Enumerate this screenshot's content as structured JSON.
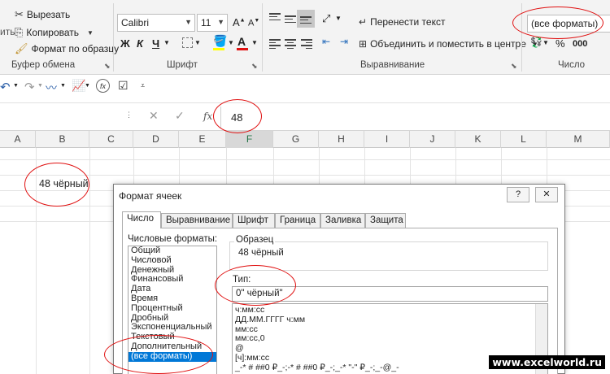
{
  "ribbon": {
    "clipboard": {
      "cut": "Вырезать",
      "copy": "Копировать",
      "format_painter": "Формат по образцу",
      "group_label": "Буфер обмена",
      "paste_fragment": "ить"
    },
    "font": {
      "name": "Calibri",
      "size": "11",
      "bold": "Ж",
      "italic": "К",
      "underline": "Ч",
      "grow": "A",
      "shrink": "A",
      "group_label": "Шрифт"
    },
    "alignment": {
      "wrap_text": "Перенести текст",
      "merge_center": "Объединить и поместить в центре",
      "group_label": "Выравнивание"
    },
    "number": {
      "format_value": "(все форматы)",
      "percent": "%",
      "comma": "000",
      "group_label": "Число"
    }
  },
  "formula_bar": {
    "value": "48",
    "fx": "fx"
  },
  "columns": [
    "A",
    "B",
    "C",
    "D",
    "E",
    "F",
    "G",
    "H",
    "I",
    "J",
    "K",
    "L",
    "M"
  ],
  "cell_b": "48 чёрный",
  "dialog": {
    "title": "Формат ячеек",
    "help": "?",
    "close": "✕",
    "tabs": [
      "Число",
      "Выравнивание",
      "Шрифт",
      "Граница",
      "Заливка",
      "Защита"
    ],
    "formats_label": "Числовые форматы:",
    "formats": [
      "Общий",
      "Числовой",
      "Денежный",
      "Финансовый",
      "Дата",
      "Время",
      "Процентный",
      "Дробный",
      "Экспоненциальный",
      "Текстовый",
      "Дополнительный",
      "(все форматы)"
    ],
    "selected_format_index": 11,
    "sample_label": "Образец",
    "sample_value": "48 чёрный",
    "type_label": "Тип:",
    "type_value": "0\" чёрный\"",
    "type_list": [
      "ч:мм:сс",
      "ДД.ММ.ГГГГ ч:мм",
      "мм:сс",
      "мм:сс,0",
      "@",
      "[ч]:мм:сс",
      "_-* # ##0 ₽_-;-* # ##0 ₽_-;_-* \"-\" ₽_-;_-@_-"
    ]
  },
  "watermark": "www.excelworld.ru",
  "colors": {
    "accent_red": "#e01010",
    "selection_blue": "#0078d7",
    "excel_green": "#217346"
  }
}
